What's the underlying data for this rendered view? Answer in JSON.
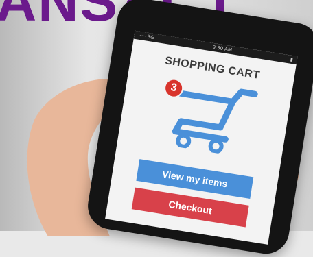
{
  "headline": {
    "text": "ANSACT"
  },
  "phone": {
    "status_bar": {
      "carrier": "····· 3G",
      "time": "9:30 AM",
      "battery": "▮"
    },
    "title": "SHOPPING CART",
    "cart": {
      "badge_count": "3",
      "icon": "shopping-cart-icon",
      "color": "#4a90d9"
    },
    "buttons": {
      "view_label": "View my items",
      "checkout_label": "Checkout"
    }
  },
  "colors": {
    "headline": "#6b1a8c",
    "badge": "#d8342c",
    "view_button": "#4a90d9",
    "checkout_button": "#d8414a"
  }
}
